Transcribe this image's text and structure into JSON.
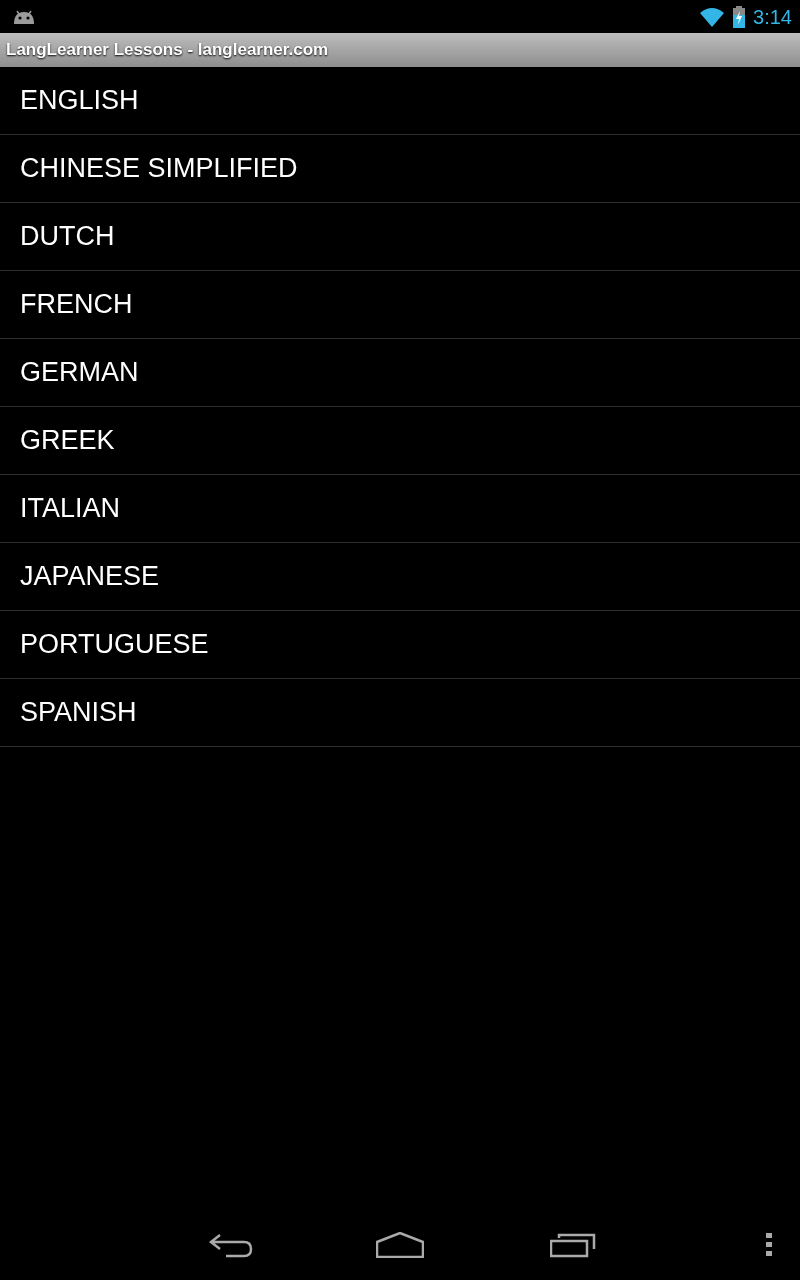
{
  "status_bar": {
    "time": "3:14"
  },
  "title_bar": {
    "title": "LangLearner Lessons - langlearner.com"
  },
  "languages": [
    {
      "label": "ENGLISH"
    },
    {
      "label": "CHINESE SIMPLIFIED"
    },
    {
      "label": "DUTCH"
    },
    {
      "label": "FRENCH"
    },
    {
      "label": "GERMAN"
    },
    {
      "label": "GREEK"
    },
    {
      "label": "ITALIAN"
    },
    {
      "label": "JAPANESE"
    },
    {
      "label": "PORTUGUESE"
    },
    {
      "label": "SPANISH"
    }
  ]
}
